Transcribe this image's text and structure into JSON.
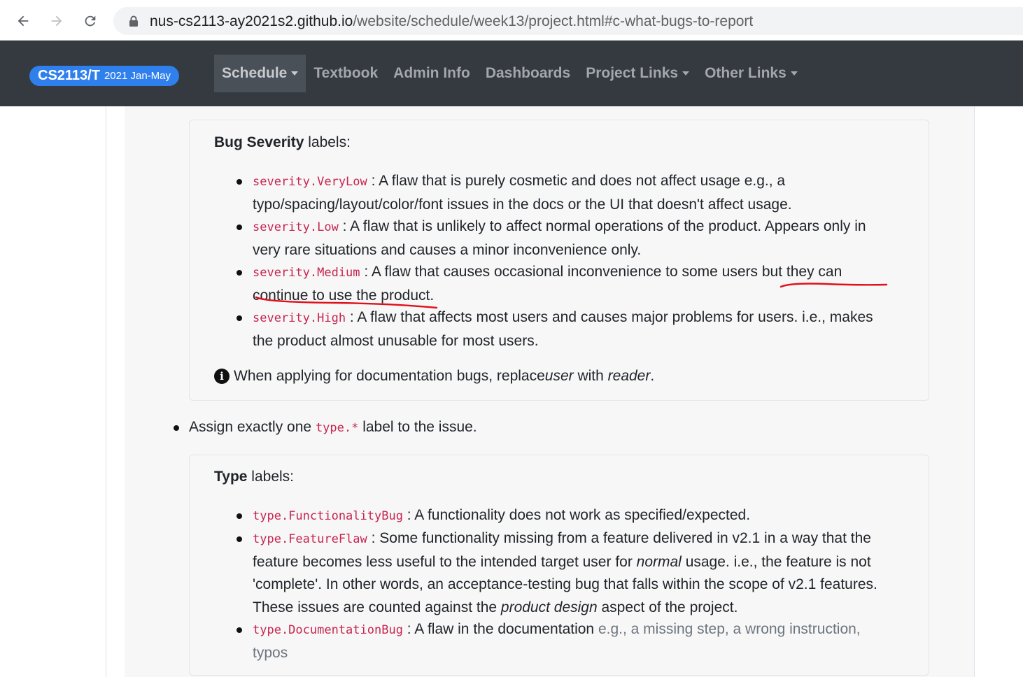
{
  "browser": {
    "url_host": "nus-cs2113-ay2021s2.github.io",
    "url_path": "/website/schedule/week13/project.html#c-what-bugs-to-report",
    "back_icon": "back-arrow-icon",
    "forward_icon": "forward-arrow-icon",
    "reload_icon": "reload-icon",
    "lock_icon": "lock-icon"
  },
  "navbar": {
    "brand_main": "CS2113/T",
    "brand_sub": "2021 Jan-May",
    "links": [
      {
        "label": "Schedule",
        "dropdown": true,
        "active": true
      },
      {
        "label": "Textbook",
        "dropdown": false
      },
      {
        "label": "Admin Info",
        "dropdown": false
      },
      {
        "label": "Dashboards",
        "dropdown": false
      },
      {
        "label": "Project Links",
        "dropdown": true
      },
      {
        "label": "Other Links",
        "dropdown": true
      }
    ],
    "colors": {
      "background": "#343a40",
      "brand": "#2f80ed"
    }
  },
  "severity_panel": {
    "title_bold": "Bug Severity",
    "title_rest": " labels:",
    "items": [
      {
        "code": "severity.VeryLow",
        "text_line1": " : A flaw that is purely cosmetic and does not affect usage e.g., a",
        "text_line2": "typo/spacing/layout/color/font issues in the docs or the UI that doesn't affect usage."
      },
      {
        "code": "severity.Low",
        "text_line1": " : A flaw that is unlikely to affect normal operations of the product. Appears only in",
        "text_line2": "very rare situations and causes a minor inconvenience only."
      },
      {
        "code": "severity.Medium",
        "text_line1": " : A flaw that causes occasional inconvenience to some users but they can",
        "text_line2": "continue to use the product."
      },
      {
        "code": "severity.High",
        "text_line1": " : A flaw that affects most users and causes major problems for users. i.e., makes",
        "text_line2": "the product almost unusable for most users."
      }
    ],
    "note_pre": "When applying for documentation bugs, replace ",
    "note_em1": "user",
    "note_mid": " with ",
    "note_em2": "reader",
    "note_post": ".",
    "note_icon": "info-circle-icon"
  },
  "assign_item": {
    "pre": "Assign exactly one ",
    "code": "type.*",
    "post": " label to the issue."
  },
  "type_panel": {
    "title_bold": "Type",
    "title_rest": " labels:",
    "item1": {
      "code": "type.FunctionalityBug",
      "text": " : A functionality does not work as specified/expected."
    },
    "item2": {
      "code": "type.FeatureFlaw",
      "line1": " : Some functionality missing from a feature delivered in v2.1 in a way that the",
      "line2_pre": "feature becomes less useful to the intended target user for ",
      "line2_em": "normal",
      "line2_post": " usage. i.e., the feature is not",
      "line3": "'complete'. In other words, an acceptance-testing bug that falls within the scope of v2.1 features.",
      "line4_pre": "These issues are counted against the ",
      "line4_em": "product design",
      "line4_post": " aspect of the project."
    },
    "item3": {
      "code": "type.DocumentationBug",
      "line1": " : A flaw in the documentation ",
      "line1_muted": "e.g., a missing step, a wrong instruction,",
      "line2_muted": "typos"
    }
  },
  "annotation": {
    "color": "#e0101a"
  }
}
